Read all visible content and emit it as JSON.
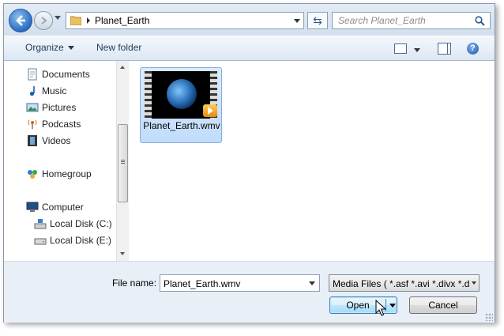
{
  "address_bar": {
    "breadcrumb": "Planet_Earth"
  },
  "search": {
    "placeholder": "Search Planet_Earth"
  },
  "toolbar": {
    "organize_label": "Organize",
    "new_folder_label": "New folder",
    "help_label": "?"
  },
  "nav_items": [
    {
      "label": "Documents",
      "icon": "documents-icon"
    },
    {
      "label": "Music",
      "icon": "music-icon"
    },
    {
      "label": "Pictures",
      "icon": "pictures-icon"
    },
    {
      "label": "Podcasts",
      "icon": "podcasts-icon"
    },
    {
      "label": "Videos",
      "icon": "videos-icon"
    },
    {
      "label": "Homegroup",
      "icon": "homegroup-icon"
    },
    {
      "label": "Computer",
      "icon": "computer-icon"
    },
    {
      "label": "Local Disk (C:)",
      "icon": "local-disk-c-icon"
    },
    {
      "label": "Local Disk (E:)",
      "icon": "local-disk-e-icon"
    }
  ],
  "files": [
    {
      "name": "Planet_Earth.wmv",
      "icon": "video-thumbnail-icon",
      "selected": true
    }
  ],
  "bottom": {
    "file_name_label": "File name:",
    "file_name_value": "Planet_Earth.wmv",
    "file_type_value": "Media Files ( *.asf *.avi *.divx *.d",
    "open_label": "Open",
    "cancel_label": "Cancel"
  },
  "colors": {
    "selection_bg": "#c1dcfc",
    "selection_border": "#84acdd",
    "accent": "#2a6bc2"
  }
}
